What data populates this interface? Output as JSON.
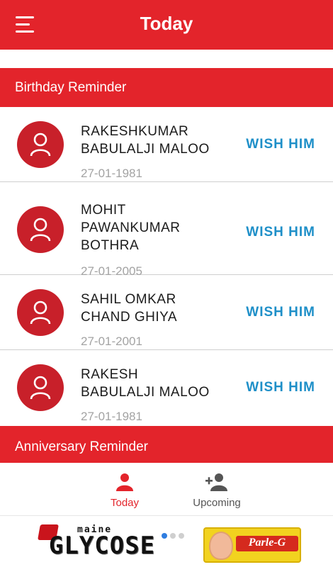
{
  "app_bar": {
    "title": "Today",
    "menu_icon": "hamburger-menu-icon"
  },
  "colors": {
    "primary": "#e3242b",
    "accent_blue": "#1e8fc8",
    "date_grey": "#a3a3a3"
  },
  "birthday_section": {
    "header": "Birthday Reminder",
    "items": [
      {
        "name_lines": [
          "RAKESHKUMAR",
          "BABULALJI MALOO"
        ],
        "date": "27-01-1981",
        "action": "WISH HIM"
      },
      {
        "name_lines": [
          "MOHIT",
          "PAWANKUMAR",
          "BOTHRA"
        ],
        "date": "27-01-2005",
        "action": "WISH HIM"
      },
      {
        "name_lines": [
          "SAHIL OMKAR",
          "CHAND GHIYA"
        ],
        "date": "27-01-2001",
        "action": "WISH HIM"
      },
      {
        "name_lines": [
          "RAKESH",
          "BABULALJI MALOO"
        ],
        "date": "27-01-1981",
        "action": "WISH HIM"
      }
    ]
  },
  "anniversary_section": {
    "header": "Anniversary Reminder"
  },
  "bottom_nav": {
    "items": [
      {
        "label": "Today",
        "icon": "person-icon",
        "active": true
      },
      {
        "label": "Upcoming",
        "icon": "add-person-icon",
        "active": false
      }
    ]
  },
  "ad_banner": {
    "glucose_text": "GLYCOSE",
    "glucose_small": "maine",
    "parle_text": "Parle-G"
  }
}
